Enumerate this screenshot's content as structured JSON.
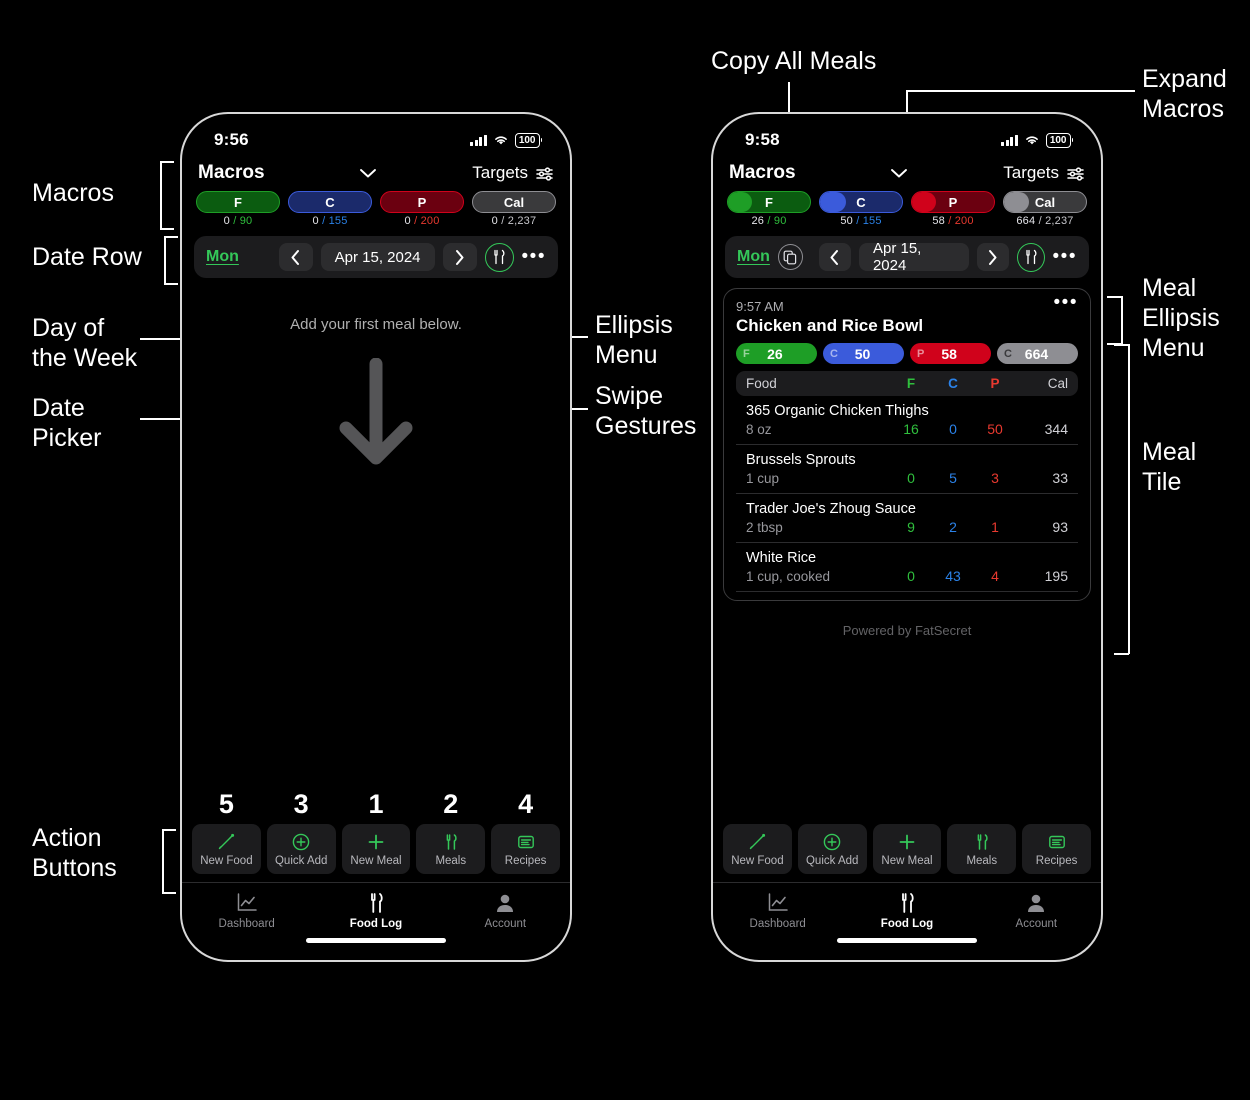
{
  "annotations": {
    "macros": "Macros",
    "date_row": "Date Row",
    "day_of_week": "Day of\nthe Week",
    "date_picker": "Date\nPicker",
    "action_buttons": "Action\nButtons",
    "ellipsis_menu": "Ellipsis\nMenu",
    "swipe_gestures": "Swipe\nGestures",
    "copy_all_meals": "Copy All Meals",
    "expand_macros": "Expand\nMacros",
    "meal_ellipsis_menu": "Meal\nEllipsis\nMenu",
    "meal_tile": "Meal\nTile"
  },
  "colors": {
    "fat": "#1e9e26",
    "fat_dark": "#0b5c10",
    "carb": "#3b5bdb",
    "carb_dark": "#1b2a6b",
    "protein": "#d0021b",
    "protein_dark": "#6b0010",
    "cal": "#8e8e93",
    "cal_dark": "#3a3a3c",
    "accent_green": "#34c759",
    "fat_text": "#2fbf3d",
    "carb_text": "#2b82e8",
    "protein_text": "#e8392f"
  },
  "left_phone": {
    "status": {
      "time": "9:56",
      "battery": "100",
      "signal_icon": "cellular-bars-icon",
      "wifi_icon": "wifi-icon"
    },
    "header": {
      "title": "Macros",
      "expand_icon": "chevron-down-icon",
      "targets_label": "Targets",
      "targets_icon": "sliders-icon"
    },
    "macro_pills": [
      {
        "key": "F",
        "label": "F",
        "current": "0",
        "goal": "90",
        "sub": "0 / 90",
        "percent": 0
      },
      {
        "key": "C",
        "label": "C",
        "current": "0",
        "goal": "155",
        "sub": "0 / 155",
        "percent": 0
      },
      {
        "key": "P",
        "label": "P",
        "current": "0",
        "goal": "200",
        "sub": "0 / 200",
        "percent": 0
      },
      {
        "key": "Cal",
        "label": "Cal",
        "current": "0",
        "goal": "2,237",
        "sub": "0 / 2,237",
        "percent": 0
      }
    ],
    "date_row": {
      "day_of_week": "Mon",
      "has_copy_button": false,
      "prev_icon": "chevron-left-icon",
      "date": "Apr 15, 2024",
      "next_icon": "chevron-right-icon",
      "meal_icon": "fork-knife-circle-icon",
      "ellipsis_icon": "ellipsis-icon"
    },
    "empty_state": {
      "text": "Add your first meal below.",
      "arrow_icon": "arrow-down-icon"
    },
    "step_numbers": [
      "5",
      "3",
      "1",
      "2",
      "4"
    ]
  },
  "right_phone": {
    "status": {
      "time": "9:58",
      "battery": "100",
      "signal_icon": "cellular-bars-icon",
      "wifi_icon": "wifi-icon"
    },
    "header": {
      "title": "Macros",
      "expand_icon": "chevron-down-icon",
      "targets_label": "Targets",
      "targets_icon": "sliders-icon"
    },
    "macro_pills": [
      {
        "key": "F",
        "label": "F",
        "current": "26",
        "goal": "90",
        "sub": "26 / 90",
        "percent": 29
      },
      {
        "key": "C",
        "label": "C",
        "current": "50",
        "goal": "155",
        "sub": "50 / 155",
        "percent": 32
      },
      {
        "key": "P",
        "label": "P",
        "current": "58",
        "goal": "200",
        "sub": "58 / 200",
        "percent": 29
      },
      {
        "key": "Cal",
        "label": "Cal",
        "current": "664",
        "goal": "2,237",
        "sub": "664 / 2,237",
        "percent": 30
      }
    ],
    "date_row": {
      "day_of_week": "Mon",
      "has_copy_button": true,
      "copy_icon": "copy-documents-icon",
      "prev_icon": "chevron-left-icon",
      "date": "Apr 15, 2024",
      "next_icon": "chevron-right-icon",
      "meal_icon": "fork-knife-circle-icon",
      "ellipsis_icon": "ellipsis-icon"
    },
    "meal_tile": {
      "time": "9:57 AM",
      "name": "Chicken and Rice Bowl",
      "ellipsis_icon": "ellipsis-icon",
      "totals": [
        {
          "label": "F",
          "value": "26"
        },
        {
          "label": "C",
          "value": "50"
        },
        {
          "label": "P",
          "value": "58"
        },
        {
          "label": "C",
          "value": "664"
        }
      ],
      "columns": {
        "food": "Food",
        "f": "F",
        "c": "C",
        "p": "P",
        "cal": "Cal"
      },
      "foods": [
        {
          "name": "365 Organic Chicken Thighs",
          "serving": "8 oz",
          "f": "16",
          "c": "0",
          "p": "50",
          "cal": "344"
        },
        {
          "name": "Brussels Sprouts",
          "serving": "1 cup",
          "f": "0",
          "c": "5",
          "p": "3",
          "cal": "33"
        },
        {
          "name": "Trader Joe's Zhoug Sauce",
          "serving": "2 tbsp",
          "f": "9",
          "c": "2",
          "p": "1",
          "cal": "93"
        },
        {
          "name": "White Rice",
          "serving": "1 cup, cooked",
          "f": "0",
          "c": "43",
          "p": "4",
          "cal": "195"
        }
      ]
    },
    "powered_by": "Powered by FatSecret"
  },
  "action_buttons": [
    {
      "label": "New Food",
      "icon": "carrot-icon"
    },
    {
      "label": "Quick Add",
      "icon": "plus-circle-icon"
    },
    {
      "label": "New Meal",
      "icon": "plus-icon"
    },
    {
      "label": "Meals",
      "icon": "fork-knife-icon"
    },
    {
      "label": "Recipes",
      "icon": "recipe-card-icon"
    }
  ],
  "tab_bar": [
    {
      "label": "Dashboard",
      "icon": "chart-line-icon",
      "active": false
    },
    {
      "label": "Food Log",
      "icon": "fork-knife-icon",
      "active": true
    },
    {
      "label": "Account",
      "icon": "person-icon",
      "active": false
    }
  ]
}
